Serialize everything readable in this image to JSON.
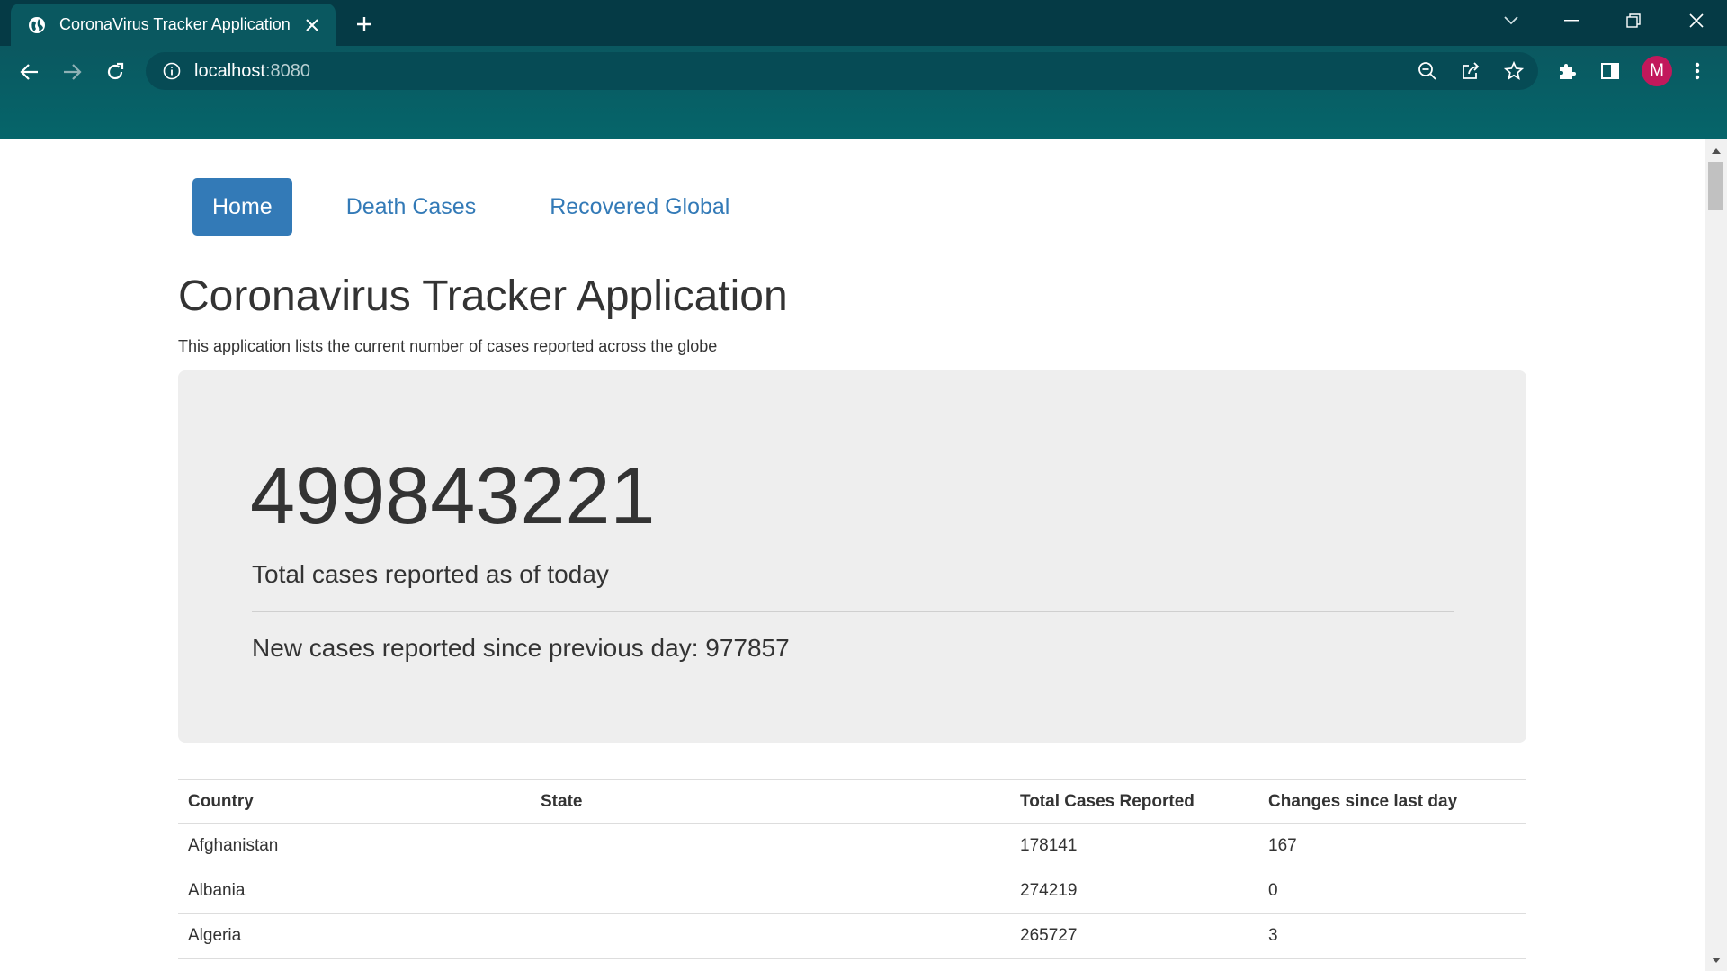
{
  "browser": {
    "tab_title": "CoronaVirus Tracker Application",
    "url_host": "localhost",
    "url_port": ":8080",
    "profile_initial": "M",
    "profile_color": "#c2185b",
    "theme_color": "#0a5860"
  },
  "nav": {
    "items": [
      {
        "label": "Home",
        "active": true
      },
      {
        "label": "Death Cases",
        "active": false
      },
      {
        "label": "Recovered Global",
        "active": false
      }
    ],
    "accent": "#337ab7"
  },
  "header": {
    "title": "Coronavirus Tracker Application",
    "subtitle": "This application lists the current number of cases reported across the globe"
  },
  "summary": {
    "total_cases": "499843221",
    "total_label": "Total cases reported as of today",
    "new_cases_text": "New cases reported since previous day: 977857"
  },
  "table": {
    "headers": [
      "Country",
      "State",
      "Total Cases Reported",
      "Changes since last day"
    ],
    "rows": [
      [
        "Afghanistan",
        "",
        "178141",
        "167"
      ],
      [
        "Albania",
        "",
        "274219",
        "0"
      ],
      [
        "Algeria",
        "",
        "265727",
        "3"
      ]
    ]
  }
}
